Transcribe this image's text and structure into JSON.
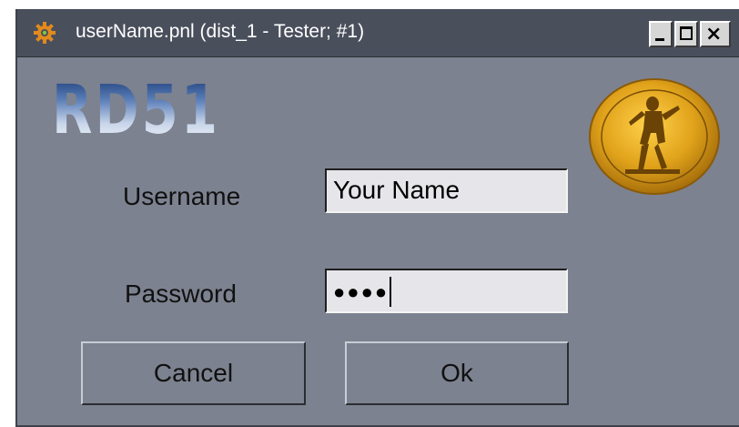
{
  "window": {
    "title": "userName.pnl (dist_1 - Tester; #1)",
    "app_icon": "gear-icon",
    "controls": {
      "minimize": "minimize-icon",
      "maximize": "maximize-icon",
      "close_label": "×"
    }
  },
  "logo": {
    "text": "RD51"
  },
  "seal": {
    "icon": "university-seal-icon"
  },
  "form": {
    "username_label": "Username",
    "username_value": "Your Name",
    "password_label": "Password",
    "password_mask": "●●●●"
  },
  "buttons": {
    "cancel_label": "Cancel",
    "ok_label": "Ok"
  },
  "colors": {
    "window_bg": "#7d8290",
    "titlebar_bg": "#4a4f5c",
    "field_bg": "#e6e6ea",
    "seal_gold": "#e0a21a"
  }
}
